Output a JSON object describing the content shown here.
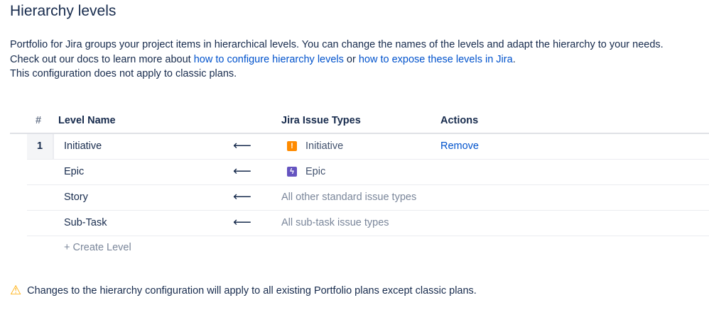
{
  "title": "Hierarchy levels",
  "desc": {
    "line1": "Portfolio for Jira groups your project items in hierarchical levels. You can change the names of the levels and adapt the hierarchy to your needs.",
    "line2_pre": "Check out our docs to learn more about ",
    "link1": "how to configure hierarchy levels",
    "line2_mid": " or ",
    "link2": "how to expose these levels in Jira",
    "line2_post": ".",
    "line3": "This configuration does not apply to classic plans."
  },
  "table": {
    "headers": {
      "num": "#",
      "name": "Level Name",
      "types": "Jira Issue Types",
      "actions": "Actions"
    },
    "rows": [
      {
        "num": "1",
        "name": "Initiative",
        "arrow": "⟵",
        "type": "Initiative",
        "icon": "!",
        "action": "Remove"
      },
      {
        "num": "",
        "name": "Epic",
        "arrow": "⟵",
        "type": "Epic",
        "icon": "ϟ"
      },
      {
        "num": "",
        "name": "Story",
        "arrow": "⟵",
        "type": "All other standard issue types"
      },
      {
        "num": "",
        "name": "Sub-Task",
        "arrow": "⟵",
        "type": "All sub-task issue types"
      }
    ],
    "create": "+ Create Level"
  },
  "warning": {
    "icon": "⚠",
    "text": "Changes to the hierarchy configuration will apply to all existing Portfolio plans except classic plans."
  },
  "colors": {
    "initiative": "#ff8b00",
    "epic": "#6554c0",
    "link": "#0052cc"
  }
}
